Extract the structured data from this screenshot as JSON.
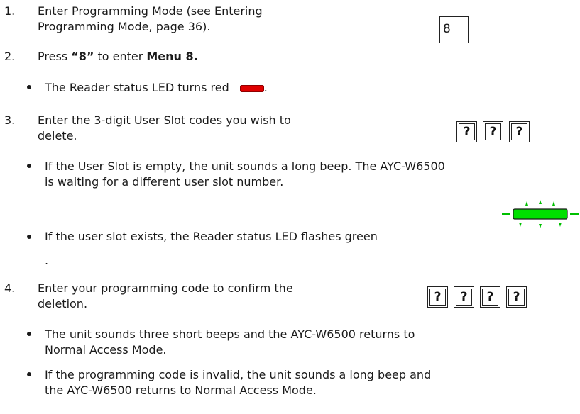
{
  "colors": {
    "led_red": "#e00000",
    "led_green": "#00e000",
    "text": "#1a1a1a"
  },
  "steps": [
    {
      "num": "1.",
      "line1": "Enter Programming Mode (see Entering",
      "line2": "Programming Mode, page 36)."
    },
    {
      "num": "2.",
      "press": "Press ",
      "key": "“8”",
      "mid": " to enter ",
      "menu": "Menu 8."
    },
    {
      "num": "3.",
      "line1": "Enter the 3-digit User Slot codes you wish to",
      "line2": "delete."
    },
    {
      "num": "4.",
      "line1": "Enter your programming code to confirm the",
      "line2": "deletion."
    }
  ],
  "bullets": {
    "red_led": {
      "text": "The Reader status LED turns red",
      "after": "."
    },
    "empty_slot": {
      "line1": "If the User Slot is empty, the unit sounds a long beep. The AYC-W6500",
      "line2": "is waiting for a different user slot number."
    },
    "slot_exists": {
      "line1": "If the user slot exists, the Reader status LED flashes green",
      "line2": "."
    },
    "three_beeps": {
      "line1": "The unit sounds three short beeps and the AYC-W6500 returns to",
      "line2": "Normal Access Mode."
    },
    "invalid_code": {
      "line1": "If the programming code is invalid, the unit sounds a long beep and",
      "line2": "the AYC-W6500 returns to Normal Access Mode."
    }
  },
  "keys": {
    "menu_key": "8",
    "user_slot": [
      "?",
      "?",
      "?"
    ],
    "program_code": [
      "?",
      "?",
      "?",
      "?"
    ]
  },
  "icons": {
    "red_led": "red-led-icon",
    "green_led": "green-led-flashing-icon"
  }
}
